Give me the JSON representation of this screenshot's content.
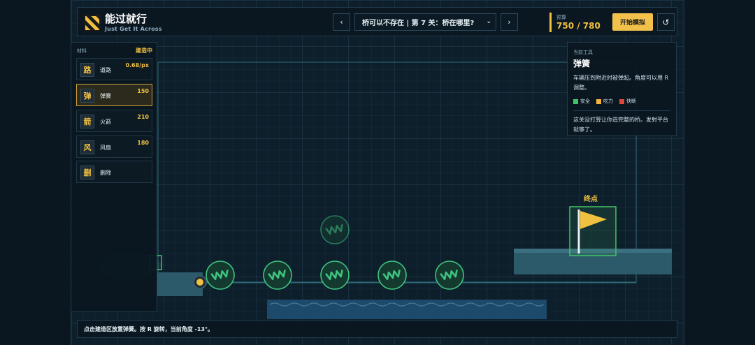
{
  "header": {
    "title": "能过就行",
    "subtitle": "Just Get It Across",
    "prev_label": "‹",
    "next_label": "›",
    "level_select": "桥可以不存在 | 第 7 关：桥在哪里?",
    "budget_label": "预算",
    "budget_value": "750 / 780",
    "start_label": "开始模拟",
    "reset_label": "↺"
  },
  "tools": {
    "header": "材料",
    "status": "建造中",
    "items": [
      {
        "key": "路",
        "name": "道路",
        "cost": "0.68/px",
        "active": false
      },
      {
        "key": "弹",
        "name": "弹簧",
        "cost": "150",
        "active": true
      },
      {
        "key": "箭",
        "name": "火箭",
        "cost": "210",
        "active": false
      },
      {
        "key": "风",
        "name": "风扇",
        "cost": "180",
        "active": false
      },
      {
        "key": "删",
        "name": "删除",
        "cost": "",
        "active": false
      }
    ]
  },
  "info": {
    "label": "当前工具",
    "title": "弹簧",
    "description": "车辆压到附近时被弹起。角度可以用 R 调整。",
    "legend": [
      {
        "label": "安全",
        "color": "#43c463"
      },
      {
        "label": "吃力",
        "color": "#f0b43c"
      },
      {
        "label": "快断",
        "color": "#e0453c"
      }
    ],
    "note": "这关没打算让你造完整的桥。发射平台就够了。"
  },
  "scene": {
    "goal_label": "终点",
    "spring_glyph": "W",
    "colors": {
      "spring": "#3fc480",
      "flag": "#f0c040",
      "water": "#1d4a6b",
      "platform": "#2d5a6b"
    }
  },
  "statusbar": {
    "text": "点击建造区放置弹簧。按 R 旋转，当前角度 -13°。"
  }
}
